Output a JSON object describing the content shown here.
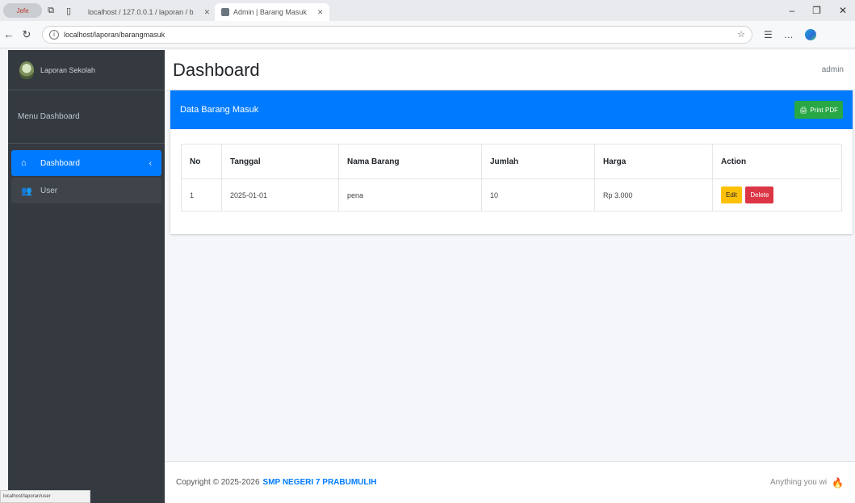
{
  "browser": {
    "profile_label": "Jefe",
    "tabs": [
      {
        "title": "localhost / 127.0.0.1 / laporan / b",
        "active": false
      },
      {
        "title": "Admin | Barang Masuk",
        "active": true
      }
    ],
    "url": "localhost/laporan/barangmasuk",
    "status_url": "localhost/laporan/user"
  },
  "sidebar": {
    "brand": "Laporan Sekolah",
    "user_panel": "Menu Dashboard",
    "items": [
      {
        "label": "Dashboard",
        "icon": "home-icon",
        "active": true
      },
      {
        "label": "User",
        "icon": "users-icon",
        "active": false
      }
    ]
  },
  "header": {
    "title": "Dashboard",
    "user": "admin"
  },
  "card": {
    "title": "Data Barang Masuk",
    "print_label": "Print PDF",
    "columns": [
      "No",
      "Tanggal",
      "Nama Barang",
      "Jumlah",
      "Harga",
      "Action"
    ],
    "rows": [
      {
        "no": "1",
        "tanggal": "2025-01-01",
        "nama": "pena",
        "jumlah": "10",
        "harga": "Rp 3.000",
        "edit": "Edit",
        "delete": "Delete"
      }
    ]
  },
  "footer": {
    "copyright": "Copyright © 2025-2026",
    "school": "SMP NEGERI 7 PRABUMULIH",
    "right_text": "Anything you wi"
  },
  "colors": {
    "primary": "#007bff",
    "sidebar": "#343a40",
    "success": "#28a745",
    "warning": "#ffc107",
    "danger": "#dc3545"
  }
}
